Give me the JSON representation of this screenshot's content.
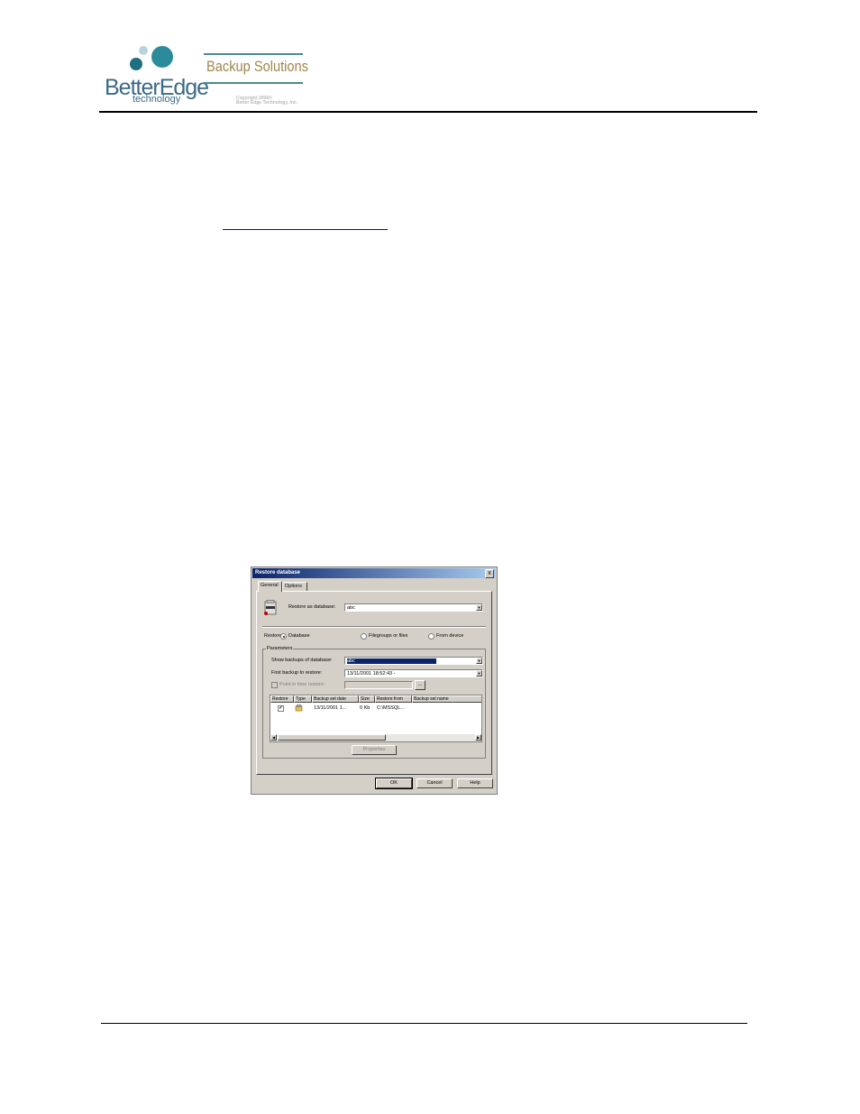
{
  "header": {
    "logo_name": "BetterEdge",
    "logo_sub": "technology",
    "brand": "Backup Solutions",
    "copyright_line1": "Copyright 2006©",
    "copyright_line2": "Better Edge Technology, Inc."
  },
  "dialog": {
    "title": "Restore database",
    "close_glyph": "x",
    "tabs": [
      "General",
      "Options"
    ],
    "restore_as_label": "Restore as database:",
    "restore_as_value": "abc",
    "restore_label": "Restore:",
    "radio_options": [
      "Database",
      "Filegroups or files",
      "From device"
    ],
    "radio_selected": "Database",
    "parameters_label": "Parameters",
    "show_backups_label": "Show backups of database:",
    "show_backups_value": "abc",
    "first_backup_label": "First backup to restore:",
    "first_backup_value": "13/11/2001 18:52:43 -",
    "point_in_time_label": "Point in time restore:",
    "browse_label": "...",
    "grid": {
      "columns": [
        "Restore",
        "Type",
        "Backup set date",
        "Size",
        "Restore from",
        "Backup set name"
      ],
      "rows": [
        {
          "restore": "✔",
          "date": "13/11/2001 1...",
          "size": "0 Kb",
          "from": "C:\\MSSQL..."
        }
      ]
    },
    "properties_button": "Properties",
    "ok_button": "OK",
    "cancel_button": "Cancel",
    "help_button": "Help"
  }
}
